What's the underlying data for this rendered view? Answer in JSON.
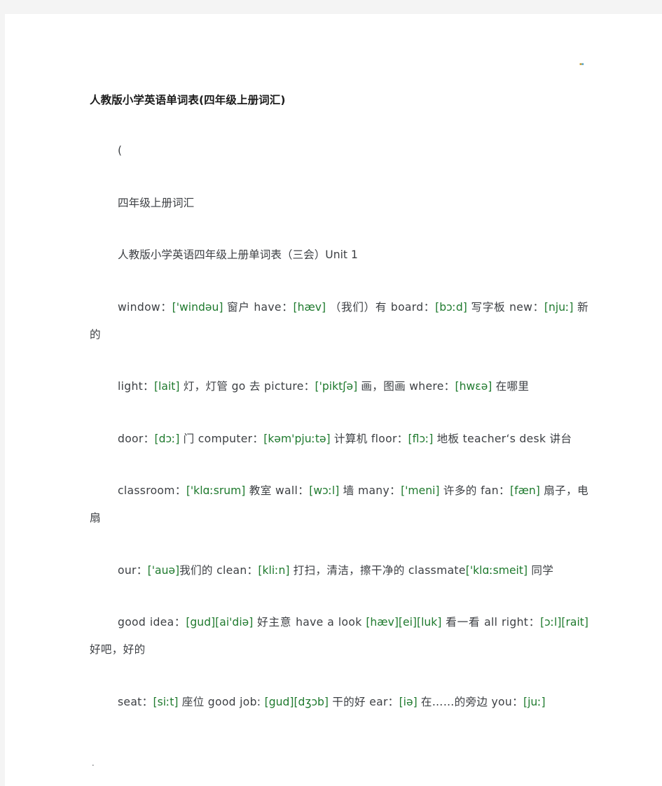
{
  "document": {
    "title": "人教版小学英语单词表(四年级上册词汇)",
    "accent_phonetic_color": "#1f7a2e",
    "text_color": "#3c3f43",
    "page_background": "#ffffff",
    "surround_background": "#f4f4f4",
    "marks": {
      "top_right_dot": "▪",
      "bottom_left_dot": "."
    },
    "paragraphs": [
      {
        "id": "p-open-paren",
        "text": "("
      },
      {
        "id": "p-subtitle",
        "text": "四年级上册词汇"
      },
      {
        "id": "p-unit-heading",
        "text": "人教版小学英语四年级上册单词表（三会）Unit 1"
      }
    ],
    "vocab_lines": [
      {
        "id": "line-window",
        "segments": [
          {
            "t": "window：",
            "k": "word"
          },
          {
            "t": "['windəu]",
            "k": "phonetic"
          },
          {
            "t": " 窗户 have：",
            "k": "word"
          },
          {
            "t": "[hæv]",
            "k": "phonetic"
          },
          {
            "t": " （我们）有 board：",
            "k": "word"
          },
          {
            "t": "[bɔːd]",
            "k": "phonetic"
          },
          {
            "t": " 写字板 new：",
            "k": "word"
          },
          {
            "t": "[njuː]",
            "k": "phonetic"
          },
          {
            "t": " 新的",
            "k": "word"
          }
        ]
      },
      {
        "id": "line-light",
        "segments": [
          {
            "t": "light：",
            "k": "word"
          },
          {
            "t": "[lait]",
            "k": "phonetic"
          },
          {
            "t": " 灯，灯管 go 去 picture：",
            "k": "word"
          },
          {
            "t": "['piktʃə]",
            "k": "phonetic"
          },
          {
            "t": " 画，图画 where：",
            "k": "word"
          },
          {
            "t": "[hwεə]",
            "k": "phonetic"
          },
          {
            "t": " 在哪里",
            "k": "word"
          }
        ]
      },
      {
        "id": "line-door",
        "segments": [
          {
            "t": "door：",
            "k": "word"
          },
          {
            "t": "[dɔː]",
            "k": "phonetic"
          },
          {
            "t": " 门 computer：",
            "k": "word"
          },
          {
            "t": "[kəm'pjuːtə]",
            "k": "phonetic"
          },
          {
            "t": " 计算机 floor：",
            "k": "word"
          },
          {
            "t": "[flɔː]",
            "k": "phonetic"
          },
          {
            "t": " 地板 teacher‘s desk 讲台",
            "k": "word"
          }
        ]
      },
      {
        "id": "line-classroom",
        "segments": [
          {
            "t": "classroom：",
            "k": "word"
          },
          {
            "t": "['klɑːsrum]",
            "k": "phonetic"
          },
          {
            "t": " 教室 wall：",
            "k": "word"
          },
          {
            "t": "[wɔːl]",
            "k": "phonetic"
          },
          {
            "t": " 墙 many：",
            "k": "word"
          },
          {
            "t": "['meni]",
            "k": "phonetic"
          },
          {
            "t": " 许多的 fan：",
            "k": "word"
          },
          {
            "t": "[fæn]",
            "k": "phonetic"
          },
          {
            "t": " 扇子，电扇",
            "k": "word"
          }
        ]
      },
      {
        "id": "line-our",
        "segments": [
          {
            "t": "our：",
            "k": "word"
          },
          {
            "t": "['auə]",
            "k": "phonetic"
          },
          {
            "t": "我们的 clean：",
            "k": "word"
          },
          {
            "t": "[kliːn]",
            "k": "phonetic"
          },
          {
            "t": " 打扫，清洁，擦干净的 classmate",
            "k": "word"
          },
          {
            "t": "['klɑːsmeit]",
            "k": "phonetic"
          },
          {
            "t": " 同学",
            "k": "word"
          }
        ]
      },
      {
        "id": "line-good-idea",
        "segments": [
          {
            "t": "good idea：",
            "k": "word"
          },
          {
            "t": "[gud][ai'diə]",
            "k": "phonetic"
          },
          {
            "t": " 好主意 have a look ",
            "k": "word"
          },
          {
            "t": "[hæv][ei][luk]",
            "k": "phonetic"
          },
          {
            "t": " 看一看 all right：",
            "k": "word"
          },
          {
            "t": "[ɔːl][rait]",
            "k": "phonetic"
          },
          {
            "t": "好吧，好的",
            "k": "word"
          }
        ]
      },
      {
        "id": "line-seat",
        "segments": [
          {
            "t": "seat：",
            "k": "word"
          },
          {
            "t": "[siːt]",
            "k": "phonetic"
          },
          {
            "t": " 座位 good job: ",
            "k": "word"
          },
          {
            "t": "[gud][dʒɔb]",
            "k": "phonetic"
          },
          {
            "t": " 干的好 ear：",
            "k": "word"
          },
          {
            "t": "[iə]",
            "k": "phonetic"
          },
          {
            "t": " 在……的旁边 you：",
            "k": "word"
          },
          {
            "t": "[juː]",
            "k": "phonetic"
          }
        ]
      }
    ]
  }
}
